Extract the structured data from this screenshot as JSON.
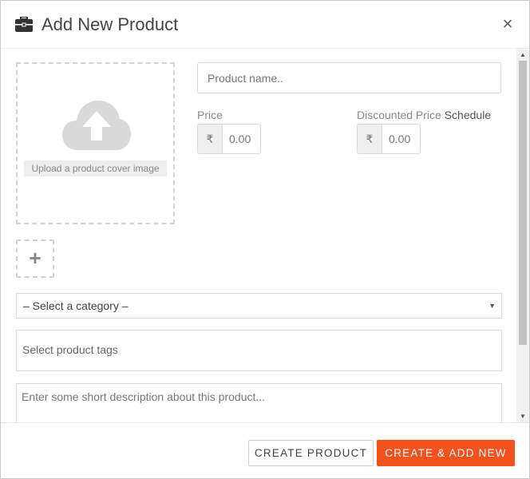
{
  "header": {
    "title": "Add New Product",
    "close_label": "×"
  },
  "cover": {
    "upload_label": "Upload a product cover image",
    "add_label": "+"
  },
  "product": {
    "name_placeholder": "Product name.."
  },
  "price": {
    "label": "Price",
    "currency_symbol": "₹",
    "placeholder": "0.00"
  },
  "discounted_price": {
    "label": "Discounted Price",
    "schedule_label": "Schedule",
    "currency_symbol": "₹",
    "placeholder": "0.00"
  },
  "category": {
    "selected": "– Select a category –"
  },
  "tags": {
    "placeholder": "Select product tags"
  },
  "description": {
    "placeholder": "Enter some short description about this product..."
  },
  "footer": {
    "create_label": "CREATE PRODUCT",
    "create_add_new_label": "CREATE & ADD NEW"
  },
  "colors": {
    "accent": "#f4511e",
    "icon_gray": "#d9d9d9"
  },
  "icons": {
    "header": "briefcase-icon",
    "upload": "cloud-upload-icon",
    "close": "close-icon",
    "dropdown": "caret-down-icon"
  }
}
